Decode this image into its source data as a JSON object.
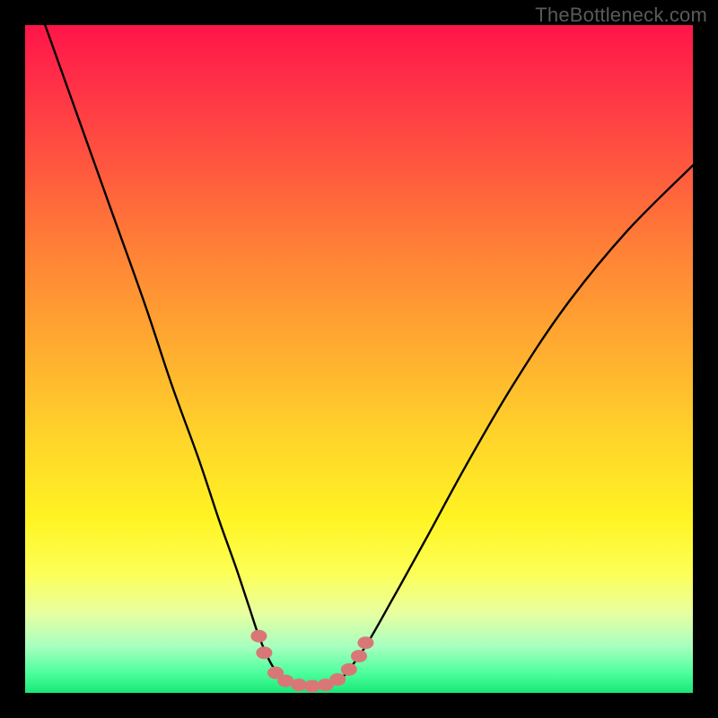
{
  "watermark": "TheBottleneck.com",
  "chart_data": {
    "type": "line",
    "title": "",
    "xlabel": "",
    "ylabel": "",
    "xlim": [
      0,
      100
    ],
    "ylim": [
      0,
      100
    ],
    "grid": false,
    "background_gradient": {
      "orientation": "vertical",
      "stops": [
        {
          "pos": 0.0,
          "color": "#ff1548"
        },
        {
          "pos": 0.5,
          "color": "#ffc828"
        },
        {
          "pos": 0.82,
          "color": "#fcff55"
        },
        {
          "pos": 1.0,
          "color": "#18e877"
        }
      ]
    },
    "series": [
      {
        "name": "left-branch",
        "x": [
          3,
          8,
          13,
          18,
          22,
          26,
          29,
          31.5,
          33.5,
          35,
          36.5,
          38
        ],
        "y": [
          100,
          86,
          72,
          58,
          46,
          35,
          26,
          19,
          13,
          8.5,
          5,
          2.5
        ]
      },
      {
        "name": "valley-floor",
        "x": [
          38,
          40,
          43,
          46,
          48
        ],
        "y": [
          2.5,
          1.2,
          1.0,
          1.3,
          2.8
        ]
      },
      {
        "name": "right-branch",
        "x": [
          48,
          51,
          55,
          60,
          66,
          73,
          81,
          90,
          100
        ],
        "y": [
          2.8,
          7,
          14,
          23,
          34,
          46,
          58,
          69,
          79
        ]
      }
    ],
    "markers": {
      "name": "valley-points",
      "color": "#d97777",
      "points": [
        {
          "x": 35.0,
          "y": 8.5
        },
        {
          "x": 35.8,
          "y": 6.0
        },
        {
          "x": 37.5,
          "y": 3.0
        },
        {
          "x": 39.0,
          "y": 1.8
        },
        {
          "x": 41.0,
          "y": 1.2
        },
        {
          "x": 43.0,
          "y": 1.0
        },
        {
          "x": 45.0,
          "y": 1.2
        },
        {
          "x": 46.8,
          "y": 2.0
        },
        {
          "x": 48.5,
          "y": 3.5
        },
        {
          "x": 50.0,
          "y": 5.5
        },
        {
          "x": 51.0,
          "y": 7.5
        }
      ]
    }
  }
}
